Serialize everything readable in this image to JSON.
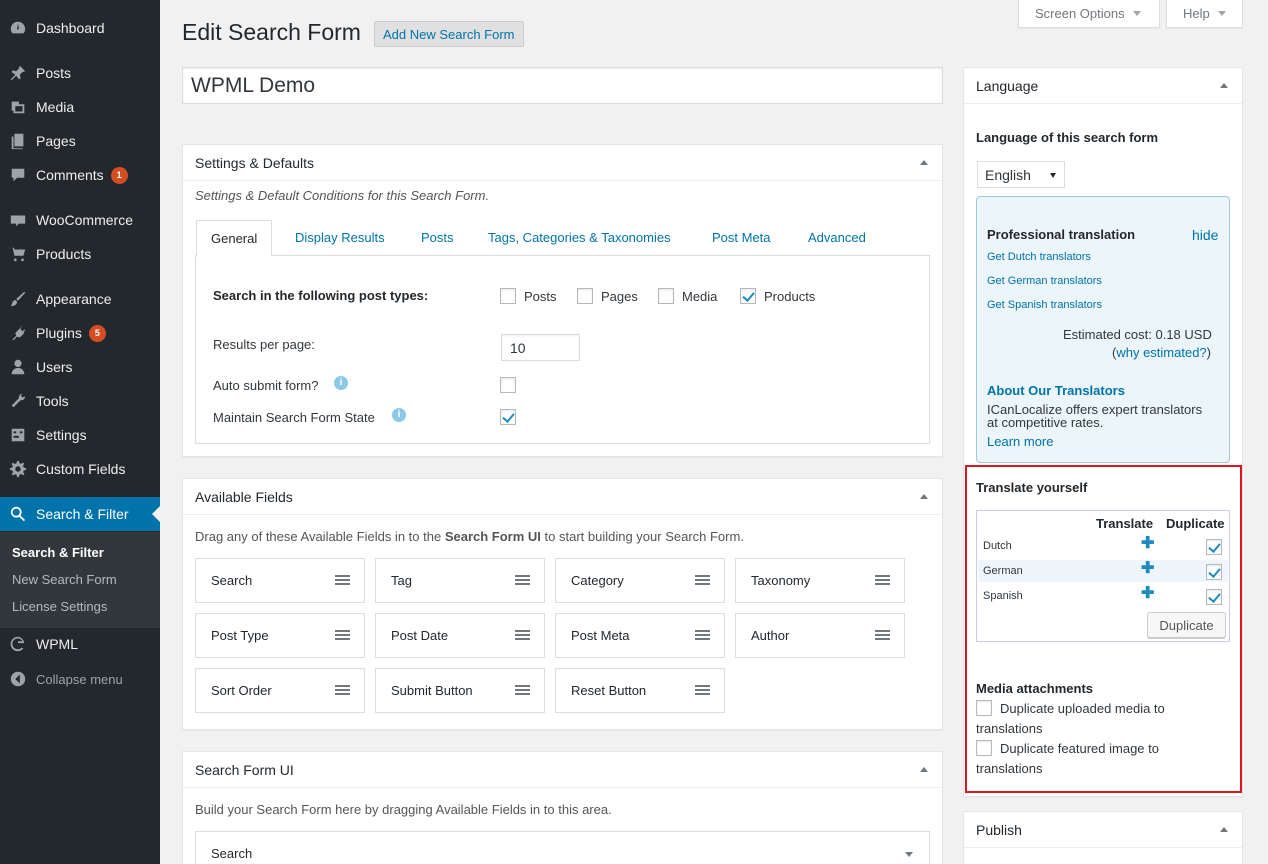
{
  "sidebar": {
    "items": [
      {
        "label": "Dashboard",
        "icon": "dashboard-icon"
      },
      {
        "label": "Posts",
        "icon": "pin-icon"
      },
      {
        "label": "Media",
        "icon": "media-icon"
      },
      {
        "label": "Pages",
        "icon": "pages-icon"
      },
      {
        "label": "Comments",
        "icon": "comment-icon",
        "badge": "1"
      },
      {
        "label": "WooCommerce",
        "icon": "woo-icon"
      },
      {
        "label": "Products",
        "icon": "cart-icon"
      },
      {
        "label": "Appearance",
        "icon": "brush-icon"
      },
      {
        "label": "Plugins",
        "icon": "plug-icon",
        "badge": "5"
      },
      {
        "label": "Users",
        "icon": "user-icon"
      },
      {
        "label": "Tools",
        "icon": "wrench-icon"
      },
      {
        "label": "Settings",
        "icon": "settings-icon"
      },
      {
        "label": "Custom Fields",
        "icon": "gear-icon"
      },
      {
        "label": "Search & Filter",
        "icon": "search-icon"
      },
      {
        "label": "WPML",
        "icon": "wpml-icon"
      }
    ],
    "submenu": [
      "Search & Filter",
      "New Search Form",
      "License Settings"
    ],
    "collapse_label": "Collapse menu"
  },
  "top": {
    "screen_options": "Screen Options",
    "help": "Help"
  },
  "header": {
    "title": "Edit Search Form",
    "add_new": "Add New Search Form"
  },
  "form_title": "WPML Demo",
  "settings_box": {
    "title": "Settings & Defaults",
    "description": "Settings & Default Conditions for this Search Form.",
    "tabs": [
      "General",
      "Display Results",
      "Posts",
      "Tags, Categories & Taxonomies",
      "Post Meta",
      "Advanced"
    ],
    "post_types_label": "Search in the following post types:",
    "post_types": [
      {
        "label": "Posts",
        "checked": false
      },
      {
        "label": "Pages",
        "checked": false
      },
      {
        "label": "Media",
        "checked": false
      },
      {
        "label": "Products",
        "checked": true
      }
    ],
    "results_per_page_label": "Results per page:",
    "results_per_page_value": "10",
    "auto_submit_label": "Auto submit form?",
    "maintain_state_label": "Maintain Search Form State"
  },
  "available_fields": {
    "title": "Available Fields",
    "desc_pre": "Drag any of these Available Fields in to the ",
    "desc_bold": "Search Form UI",
    "desc_post": " to start building your Search Form.",
    "fields": [
      "Search",
      "Tag",
      "Category",
      "Taxonomy",
      "Post Type",
      "Post Date",
      "Post Meta",
      "Author",
      "Sort Order",
      "Submit Button",
      "Reset Button"
    ]
  },
  "search_form_ui": {
    "title": "Search Form UI",
    "description": "Build your Search Form here by dragging Available Fields in to this area.",
    "first_field": "Search"
  },
  "language_box": {
    "title": "Language",
    "label": "Language of this search form",
    "selected": "English",
    "pro": {
      "title": "Professional translation",
      "hide": "hide",
      "links": [
        "Get Dutch translators",
        "Get German translators",
        "Get Spanish translators"
      ],
      "cost": "Estimated cost: 0.18 USD",
      "why_pre": "(",
      "why_link": "why estimated?",
      "why_post": ")",
      "about_title": "About Our Translators",
      "about_text_1": "ICanLocalize offers expert translators",
      "about_text_2": "at competitive rates.",
      "learn_more": "Learn more"
    },
    "translate_yourself": "Translate yourself",
    "col_translate": "Translate",
    "col_duplicate": "Duplicate",
    "languages": [
      "Dutch",
      "German",
      "Spanish"
    ],
    "duplicate_btn": "Duplicate",
    "media_title": "Media attachments",
    "media_opt1_a": "Duplicate uploaded media to",
    "media_opt1_b": "translations",
    "media_opt2_a": "Duplicate featured image to",
    "media_opt2_b": "translations"
  },
  "publish_box": {
    "title": "Publish"
  },
  "colors": {
    "sidebar": "#23282d",
    "accent": "#0073aa",
    "highlight": "#e0141e",
    "badge": "#d54e21"
  }
}
